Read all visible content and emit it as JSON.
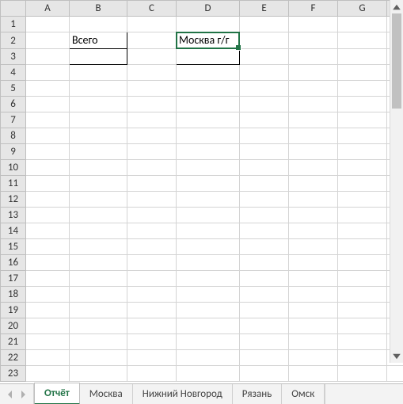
{
  "columns": [
    "A",
    "B",
    "C",
    "D",
    "E",
    "F",
    "G"
  ],
  "rows": [
    "1",
    "2",
    "3",
    "4",
    "5",
    "6",
    "7",
    "8",
    "9",
    "10",
    "11",
    "12",
    "13",
    "14",
    "15",
    "16",
    "17",
    "18",
    "19",
    "20",
    "21",
    "22",
    "23"
  ],
  "active_cell": "D2",
  "cells": {
    "B2": "Всего",
    "D2": "Москва г/г"
  },
  "tabs": {
    "items": [
      "Отчёт",
      "Москва",
      "Нижний Новгород",
      "Рязань",
      "Омск"
    ],
    "active_index": 0
  }
}
